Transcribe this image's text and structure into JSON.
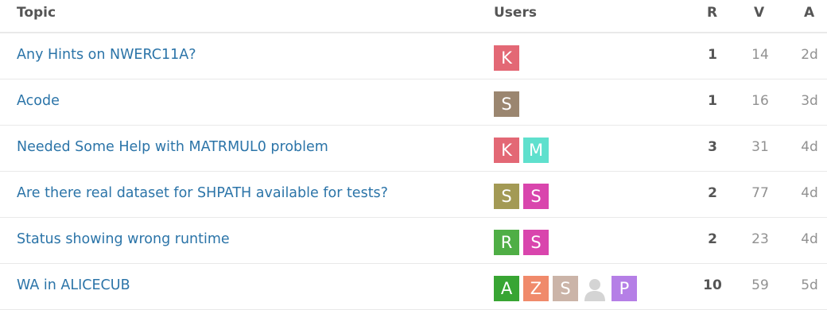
{
  "header": {
    "topic": "Topic",
    "users": "Users",
    "replies": "R",
    "views": "V",
    "activity": "A"
  },
  "rows": [
    {
      "title": "Any Hints on NWERC11A?",
      "users": [
        {
          "letter": "K",
          "color": "#e36875"
        }
      ],
      "replies": "1",
      "views": "14",
      "activity": "2d"
    },
    {
      "title": "Acode",
      "users": [
        {
          "letter": "S",
          "color": "#9b8670"
        }
      ],
      "replies": "1",
      "views": "16",
      "activity": "3d"
    },
    {
      "title": "Needed Some Help with MATRMUL0 problem",
      "users": [
        {
          "letter": "K",
          "color": "#e36875"
        },
        {
          "letter": "M",
          "color": "#5fe0cd"
        }
      ],
      "replies": "3",
      "views": "31",
      "activity": "4d"
    },
    {
      "title": "Are there real dataset for SHPATH available for tests?",
      "users": [
        {
          "letter": "S",
          "color": "#a39a55"
        },
        {
          "letter": "S",
          "color": "#d945ad"
        }
      ],
      "replies": "2",
      "views": "77",
      "activity": "4d"
    },
    {
      "title": "Status showing wrong runtime",
      "users": [
        {
          "letter": "R",
          "color": "#4fae45"
        },
        {
          "letter": "S",
          "color": "#d945ad"
        }
      ],
      "replies": "2",
      "views": "23",
      "activity": "4d"
    },
    {
      "title": "WA in ALICECUB",
      "users": [
        {
          "letter": "A",
          "color": "#38a533"
        },
        {
          "letter": "Z",
          "color": "#f08a6b"
        },
        {
          "letter": "S",
          "color": "#cbb4a8"
        },
        {
          "letter": "",
          "color": "#ffffff",
          "icon": "default-user-icon"
        },
        {
          "letter": "P",
          "color": "#b57fe6"
        }
      ],
      "replies": "10",
      "views": "59",
      "activity": "5d"
    }
  ]
}
